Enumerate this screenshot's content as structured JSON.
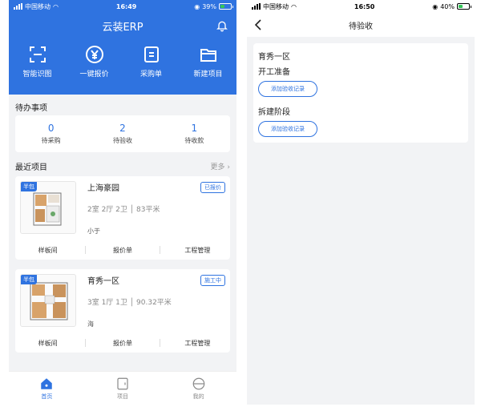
{
  "left": {
    "status": {
      "carrier": "中国移动",
      "time": "16:49",
      "battery": "39%"
    },
    "app_title": "云装ERP",
    "quick_actions": [
      {
        "label": "智能识图",
        "icon": "scan-icon"
      },
      {
        "label": "一键报价",
        "icon": "yen-icon"
      },
      {
        "label": "采购单",
        "icon": "document-icon"
      },
      {
        "label": "新建项目",
        "icon": "folder-icon"
      }
    ],
    "todo": {
      "title": "待办事项",
      "items": [
        {
          "count": "0",
          "label": "待采购"
        },
        {
          "count": "2",
          "label": "待验收"
        },
        {
          "count": "1",
          "label": "待收款"
        }
      ]
    },
    "recent": {
      "title": "最近项目",
      "more": "更多 ›",
      "projects": [
        {
          "tag": "半包",
          "name": "上海豪园",
          "status": "已报价",
          "info": "2室 2厅 2卫 │ 83平米",
          "owner": "小于",
          "links": [
            "样板间",
            "报价单",
            "工程管理"
          ]
        },
        {
          "tag": "半包",
          "name": "育秀一区",
          "status": "施工中",
          "info": "3室 1厅 1卫 │ 90.32平米",
          "owner": "海",
          "links": [
            "样板间",
            "报价单",
            "工程管理"
          ]
        }
      ]
    },
    "tabs": [
      {
        "label": "首页",
        "icon": "home-icon"
      },
      {
        "label": "项目",
        "icon": "project-icon"
      },
      {
        "label": "我的",
        "icon": "profile-icon"
      }
    ]
  },
  "right": {
    "status": {
      "carrier": "中国移动",
      "time": "16:50",
      "battery": "40%"
    },
    "nav_title": "待验收",
    "project": "育秀一区",
    "phases": [
      {
        "name": "开工准备",
        "button": "添加验收记录"
      },
      {
        "name": "拆建阶段",
        "button": "添加验收记录"
      }
    ]
  },
  "colors": {
    "primary": "#2f73e0",
    "background": "#f2f3f5"
  }
}
